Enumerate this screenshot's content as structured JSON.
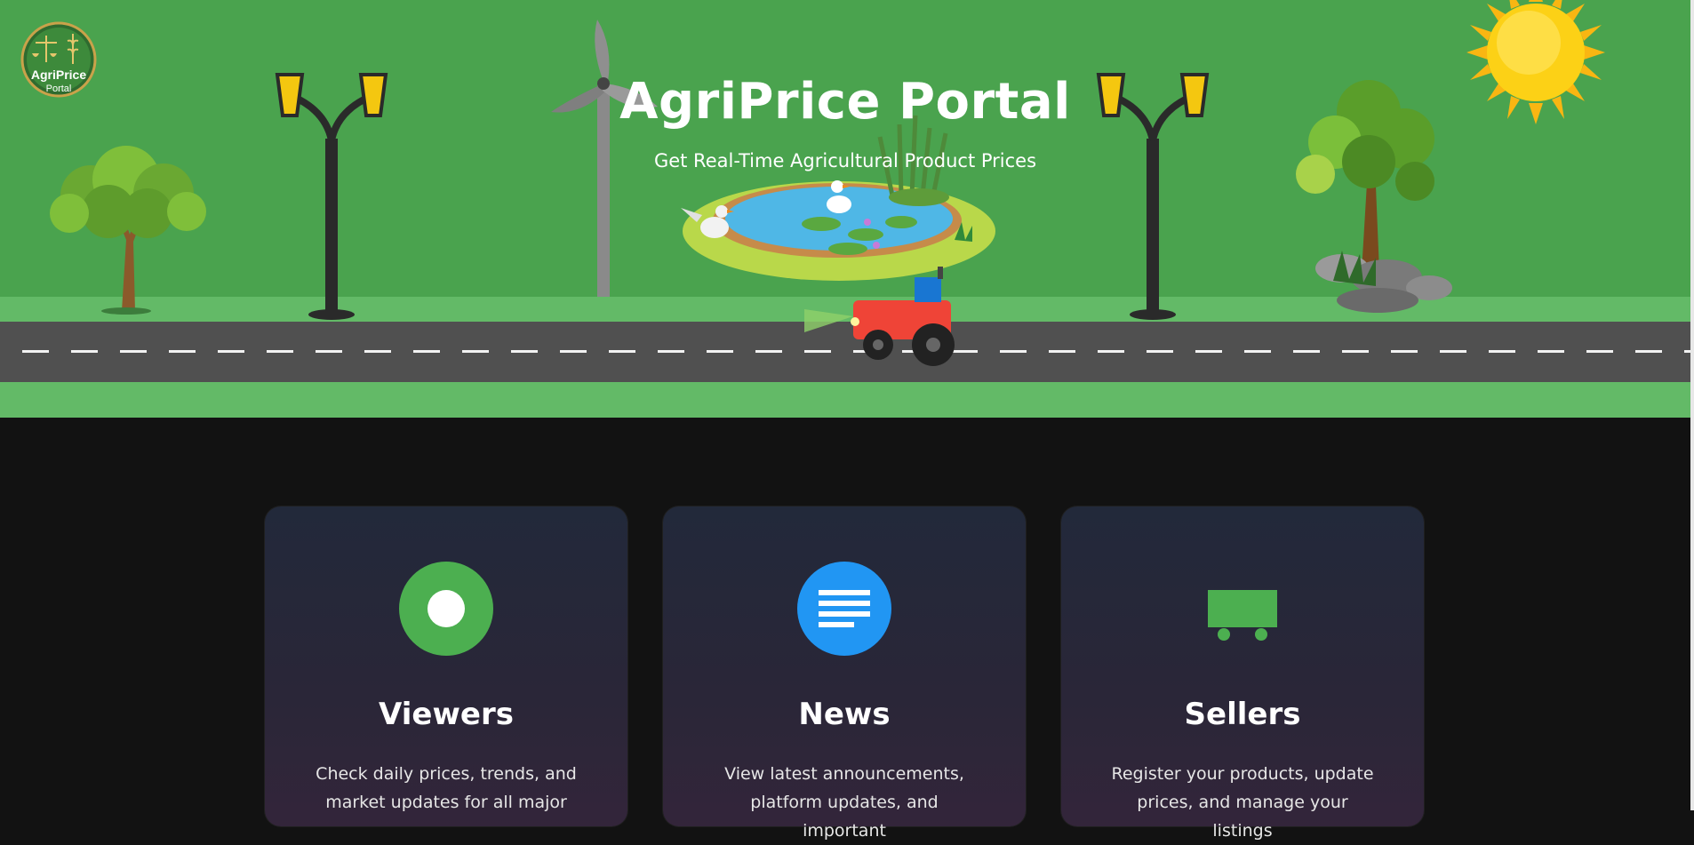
{
  "hero": {
    "logo_text_line1": "AgriPrice",
    "logo_text_line2": "Portal",
    "title": "AgriPrice Portal",
    "subtitle": "Get Real-Time Agricultural Product Prices"
  },
  "cards": [
    {
      "title": "Viewers",
      "description": "Check daily prices, trends, and market updates for all major",
      "icon": "viewer-icon",
      "icon_color": "#4caf50"
    },
    {
      "title": "News",
      "description": "View latest announcements, platform updates, and important",
      "icon": "news-icon",
      "icon_color": "#2196f3"
    },
    {
      "title": "Sellers",
      "description": "Register your products, update prices, and manage your listings",
      "icon": "cart-icon",
      "icon_color": "#4caf50"
    }
  ],
  "colors": {
    "hero_background": "#4aa34e",
    "grass": "#63ba67",
    "road": "#505050",
    "page_background": "#121212"
  }
}
